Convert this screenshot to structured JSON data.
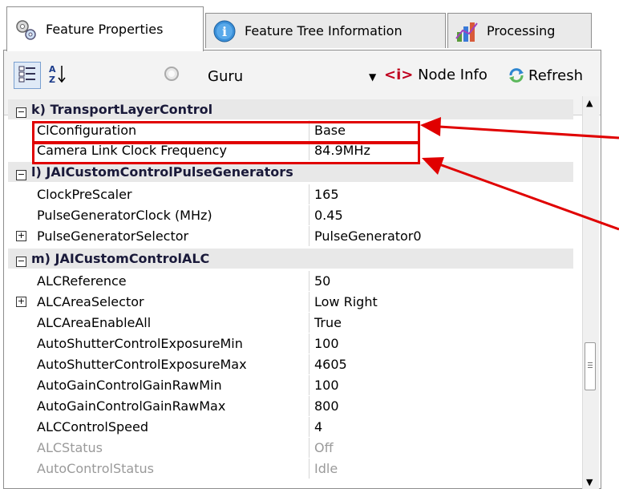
{
  "tabs": [
    {
      "label": "Feature Properties",
      "icon": "gears-icon",
      "active": true
    },
    {
      "label": "Feature Tree Information",
      "icon": "info-icon",
      "active": false
    },
    {
      "label": "Processing",
      "icon": "chart-icon",
      "active": false
    }
  ],
  "toolbar": {
    "visibility_value": "Guru",
    "node_info_tag": "<i>",
    "node_info_label": "Node Info",
    "refresh_label": "Refresh"
  },
  "categories": [
    {
      "label": "k) TransportLayerControl"
    },
    {
      "label": "l) JAICustomControlPulseGenerators"
    },
    {
      "label": "m) JAICustomControlALC"
    }
  ],
  "properties": [
    {
      "name": "ClConfiguration",
      "value": "Base"
    },
    {
      "name": "Camera Link Clock Frequency",
      "value": "84.9MHz"
    },
    {
      "name": "ClockPreScaler",
      "value": "165"
    },
    {
      "name": "PulseGeneratorClock (MHz)",
      "value": "0.45"
    },
    {
      "name": "PulseGeneratorSelector",
      "value": "PulseGenerator0"
    },
    {
      "name": "ALCReference",
      "value": "50"
    },
    {
      "name": "ALCAreaSelector",
      "value": "Low Right"
    },
    {
      "name": "ALCAreaEnableAll",
      "value": "True"
    },
    {
      "name": "AutoShutterControlExposureMin",
      "value": "100"
    },
    {
      "name": "AutoShutterControlExposureMax",
      "value": "4605"
    },
    {
      "name": "AutoGainControlGainRawMin",
      "value": "100"
    },
    {
      "name": "AutoGainControlGainRawMax",
      "value": "800"
    },
    {
      "name": "ALCControlSpeed",
      "value": "4"
    },
    {
      "name": "ALCStatus",
      "value": "Off"
    },
    {
      "name": "AutoControlStatus",
      "value": "Idle"
    }
  ],
  "expander_symbols": {
    "collapse": "−",
    "expand": "+"
  },
  "colors": {
    "highlight": "#e00000",
    "node_info_tag": "#c0001e"
  }
}
